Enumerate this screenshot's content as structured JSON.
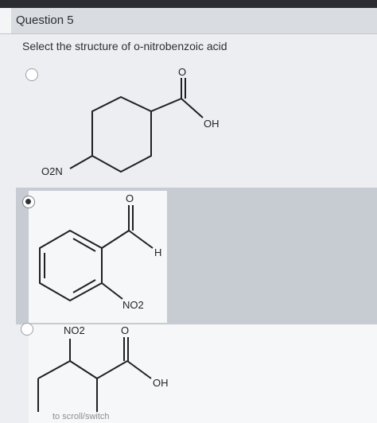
{
  "question": {
    "title": "Question 5",
    "prompt": "Select the structure of o-nitrobenzoic acid"
  },
  "options": [
    {
      "selected": false,
      "labels": {
        "o": "O",
        "oh": "OH",
        "no2": "O2N"
      }
    },
    {
      "selected": true,
      "labels": {
        "o": "O",
        "h": "H",
        "no2": "NO2"
      }
    },
    {
      "selected": false,
      "labels": {
        "o": "O",
        "oh": "OH",
        "no2": "NO2"
      }
    }
  ],
  "footer": "to scroll/switch"
}
